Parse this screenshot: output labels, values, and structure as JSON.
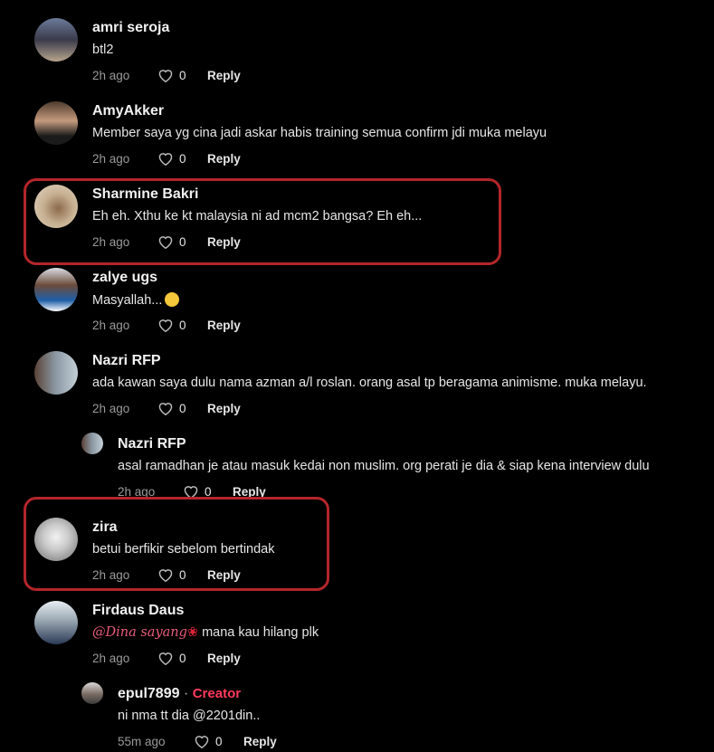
{
  "comments": [
    {
      "name": "amri seroja",
      "text": "btl2",
      "time": "2h ago",
      "likes": "0",
      "reply": "Reply"
    },
    {
      "name": "AmyAkker",
      "text": "Member saya yg cina jadi askar habis training semua confirm jdi muka melayu",
      "time": "2h ago",
      "likes": "0",
      "reply": "Reply"
    },
    {
      "name": "Sharmine Bakri",
      "text": "Eh eh. Xthu ke kt malaysia ni ad mcm2 bangsa? Eh eh...",
      "time": "2h ago",
      "likes": "0",
      "reply": "Reply"
    },
    {
      "name": "zalye ugs",
      "text": "Masyallah...",
      "time": "2h ago",
      "likes": "0",
      "reply": "Reply"
    },
    {
      "name": "Nazri RFP",
      "text": "ada kawan saya dulu nama azman a/l roslan. orang asal tp beragama animisme. muka melayu.",
      "time": "2h ago",
      "likes": "0",
      "reply": "Reply"
    },
    {
      "name": "Nazri RFP",
      "text": "asal ramadhan je atau masuk kedai non muslim. org perati je dia & siap kena interview dulu",
      "time": "2h ago",
      "likes": "0",
      "reply": "Reply"
    },
    {
      "name": "zira",
      "text": "betui berfikir sebelom bertindak",
      "time": "2h ago",
      "likes": "0",
      "reply": "Reply"
    },
    {
      "name": "Firdaus Daus",
      "mention": "@Dina sayang",
      "text": "mana kau hilang plk",
      "time": "2h ago",
      "likes": "0",
      "reply": "Reply"
    },
    {
      "name": "epul7899",
      "badge": "Creator",
      "text": "ni nma tt dia @2201din..",
      "time": "55m ago",
      "likes": "0",
      "reply": "Reply"
    }
  ]
}
